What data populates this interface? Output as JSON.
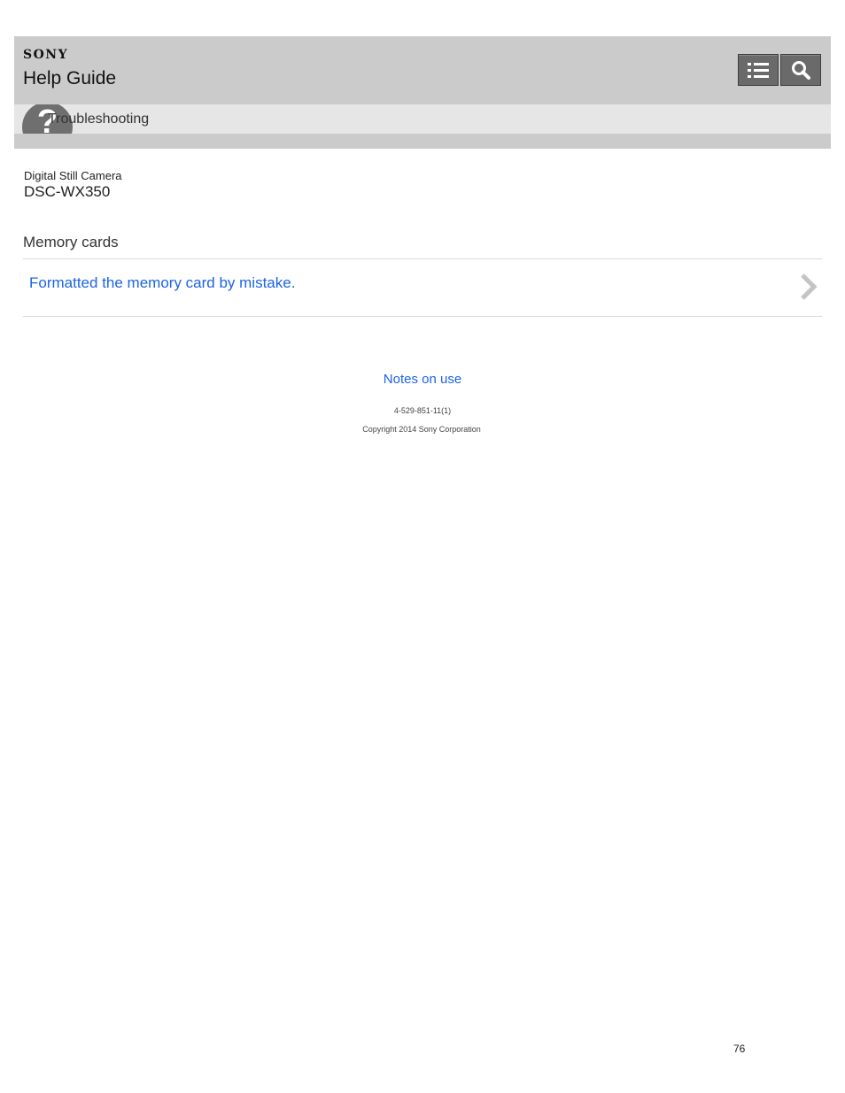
{
  "header": {
    "brand": "SONY",
    "title": "Help Guide",
    "toc_icon": "list-icon",
    "search_icon": "search-icon"
  },
  "category": {
    "icon": "question-icon",
    "icon_glyph": "?",
    "label": "Troubleshooting"
  },
  "product": {
    "type": "Digital Still Camera",
    "model": "DSC-WX350"
  },
  "section": {
    "heading": "Memory cards",
    "links": [
      {
        "label": "Formatted the memory card by mistake.",
        "icon": "chevron-right-icon"
      }
    ]
  },
  "footer": {
    "notes_link": "Notes on use",
    "doc_number": "4-529-851-11(1)",
    "copyright": "Copyright 2014 Sony Corporation"
  },
  "page_number": "76",
  "colors": {
    "header_bg": "#cbcbcb",
    "category_bg": "#e6e6e6",
    "button_bg": "#6a6a6a",
    "link": "#1a64e6"
  }
}
